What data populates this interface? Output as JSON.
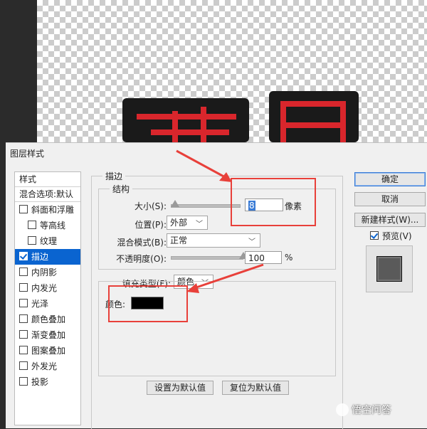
{
  "dialog": {
    "title": "图层样式"
  },
  "styles_panel": {
    "header": "样式",
    "blend_options": "混合选项:默认",
    "items": [
      {
        "label": "斜面和浮雕",
        "checked": false,
        "indent": false,
        "selected": false
      },
      {
        "label": "等高线",
        "checked": false,
        "indent": true,
        "selected": false
      },
      {
        "label": "纹理",
        "checked": false,
        "indent": true,
        "selected": false
      },
      {
        "label": "描边",
        "checked": true,
        "indent": false,
        "selected": true
      },
      {
        "label": "内阴影",
        "checked": false,
        "indent": false,
        "selected": false
      },
      {
        "label": "内发光",
        "checked": false,
        "indent": false,
        "selected": false
      },
      {
        "label": "光泽",
        "checked": false,
        "indent": false,
        "selected": false
      },
      {
        "label": "颜色叠加",
        "checked": false,
        "indent": false,
        "selected": false
      },
      {
        "label": "渐变叠加",
        "checked": false,
        "indent": false,
        "selected": false
      },
      {
        "label": "图案叠加",
        "checked": false,
        "indent": false,
        "selected": false
      },
      {
        "label": "外发光",
        "checked": false,
        "indent": false,
        "selected": false
      },
      {
        "label": "投影",
        "checked": false,
        "indent": false,
        "selected": false
      }
    ]
  },
  "stroke": {
    "section_title": "描边",
    "structure_title": "结构",
    "size_label": "大小(S):",
    "size_value": "8",
    "size_unit": "像素",
    "position_label": "位置(P):",
    "position_value": "外部",
    "blend_label": "混合模式(B):",
    "blend_value": "正常",
    "opacity_label": "不透明度(O):",
    "opacity_value": "100",
    "opacity_unit": "%",
    "fill_type_label": "填充类型(F):",
    "fill_type_value": "颜色",
    "color_label": "颜色:",
    "color_hex": "#000000",
    "set_default": "设置为默认值",
    "reset_default": "复位为默认值"
  },
  "buttons": {
    "ok": "确定",
    "cancel": "取消",
    "new_style": "新建样式(W)...",
    "preview": "预览(V)",
    "preview_checked": true
  },
  "watermark": "悟空问答",
  "colors": {
    "accent": "#0a64d0",
    "annotation": "#e8403a",
    "glyph_red": "#d9262c"
  }
}
